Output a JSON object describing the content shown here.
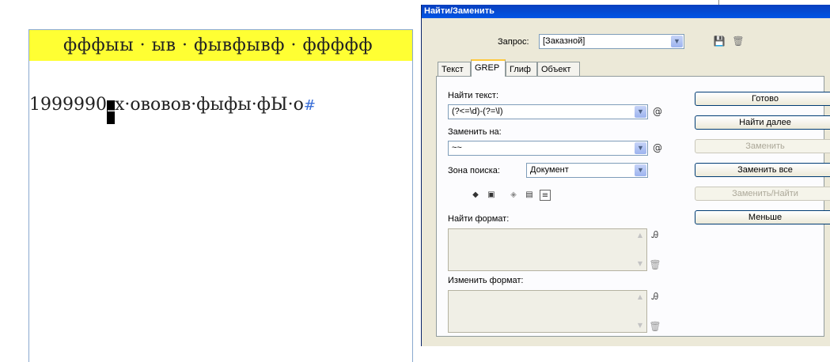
{
  "document": {
    "line1": "фффыы · ыв · фывфывф · ффффф",
    "line2_before": "1999990",
    "line2_cursor": "–",
    "line2_after": "x·ововов·фыфы·фЫ·о",
    "line2_mark": "#"
  },
  "dialog": {
    "title": "Найти/Заменить",
    "query_label": "Запрос:",
    "query_value": "[Заказной]",
    "tabs": [
      {
        "label": "Текст"
      },
      {
        "label": "GREP"
      },
      {
        "label": "Глиф"
      },
      {
        "label": "Объект"
      }
    ],
    "find_label": "Найти текст:",
    "find_value": "(?<=\\d)-(?=\\l)",
    "replace_label": "Заменить на:",
    "replace_value": "~~",
    "scope_label": "Зона поиска:",
    "scope_value": "Документ",
    "find_format_label": "Найти формат:",
    "change_format_label": "Изменить формат:",
    "buttons": {
      "done": "Готово",
      "find_next": "Найти далее",
      "replace": "Заменить",
      "replace_all": "Заменить все",
      "replace_find": "Заменить/Найти",
      "fewer": "Меньше"
    },
    "icons": {
      "save": "save-query-icon",
      "delete": "delete-query-icon",
      "special_chars": "special-characters-icon",
      "format": "specify-format-icon",
      "trash": "clear-format-icon"
    }
  }
}
